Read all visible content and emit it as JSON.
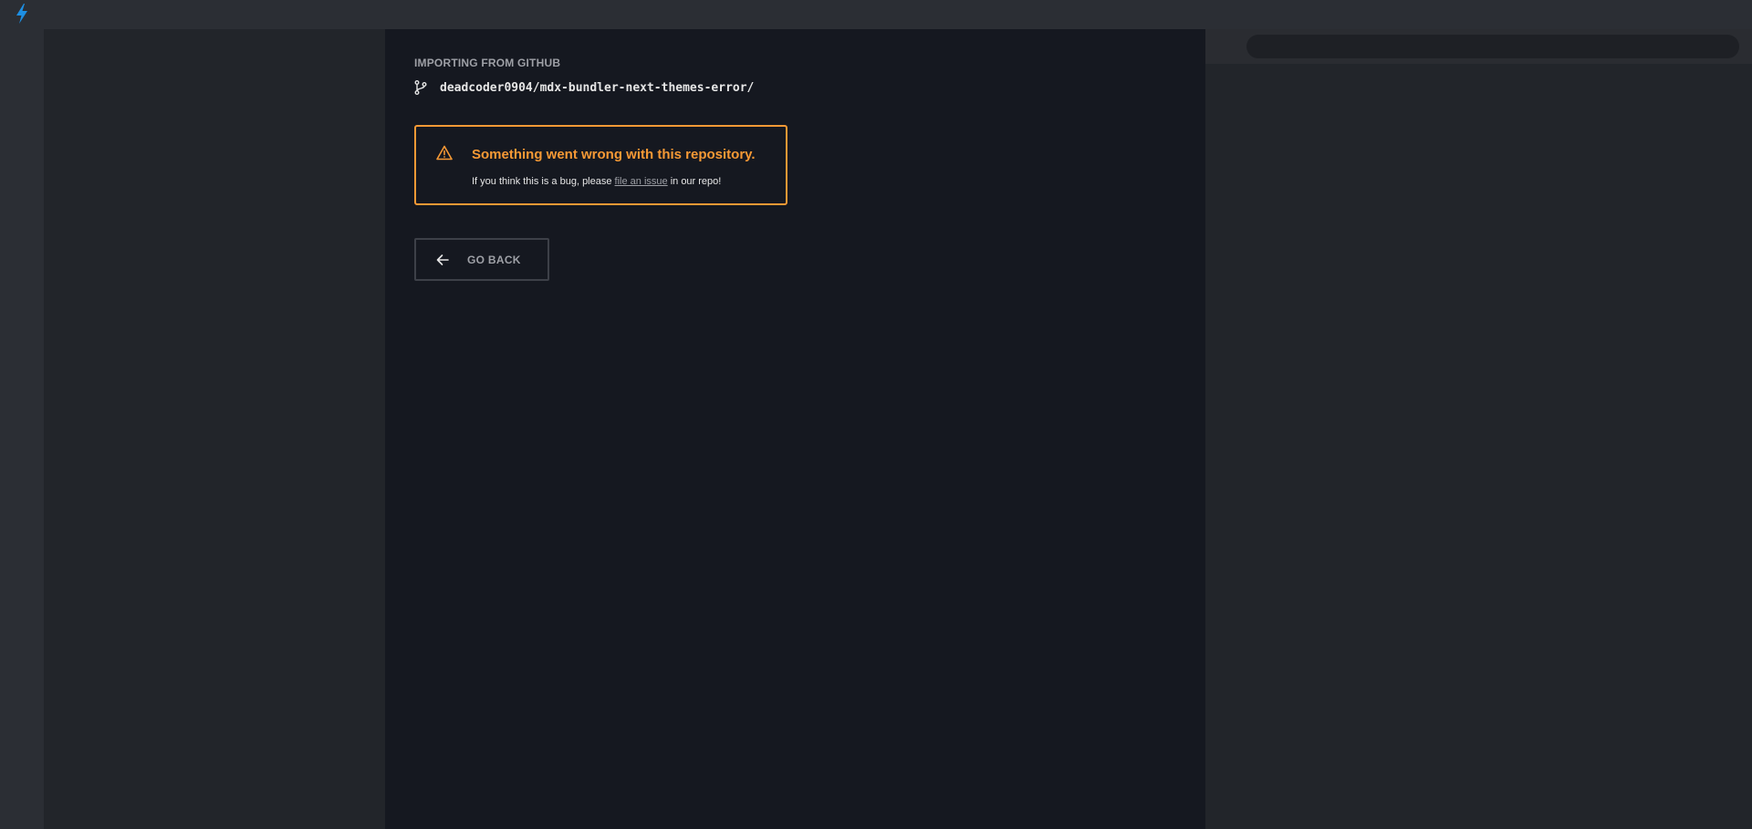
{
  "colors": {
    "accent": "#f69935",
    "logo": "#1d8fe3",
    "text": "#e6e6e6",
    "muted": "#9ea0a6"
  },
  "topbar": {
    "logo_icon": "bolt-icon"
  },
  "importer": {
    "label": "IMPORTING FROM GITHUB",
    "repo_icon": "git-branch-icon",
    "repo": "deadcoder0904/mdx-bundler-next-themes-error/"
  },
  "error": {
    "icon": "warning-icon",
    "title": "Something went wrong with this repository.",
    "message_prefix": "If you think this is a bug, please ",
    "link_text": "file an issue",
    "message_suffix": " in our repo!"
  },
  "actions": {
    "go_back_icon": "arrow-left-icon",
    "go_back_label": "GO BACK"
  }
}
